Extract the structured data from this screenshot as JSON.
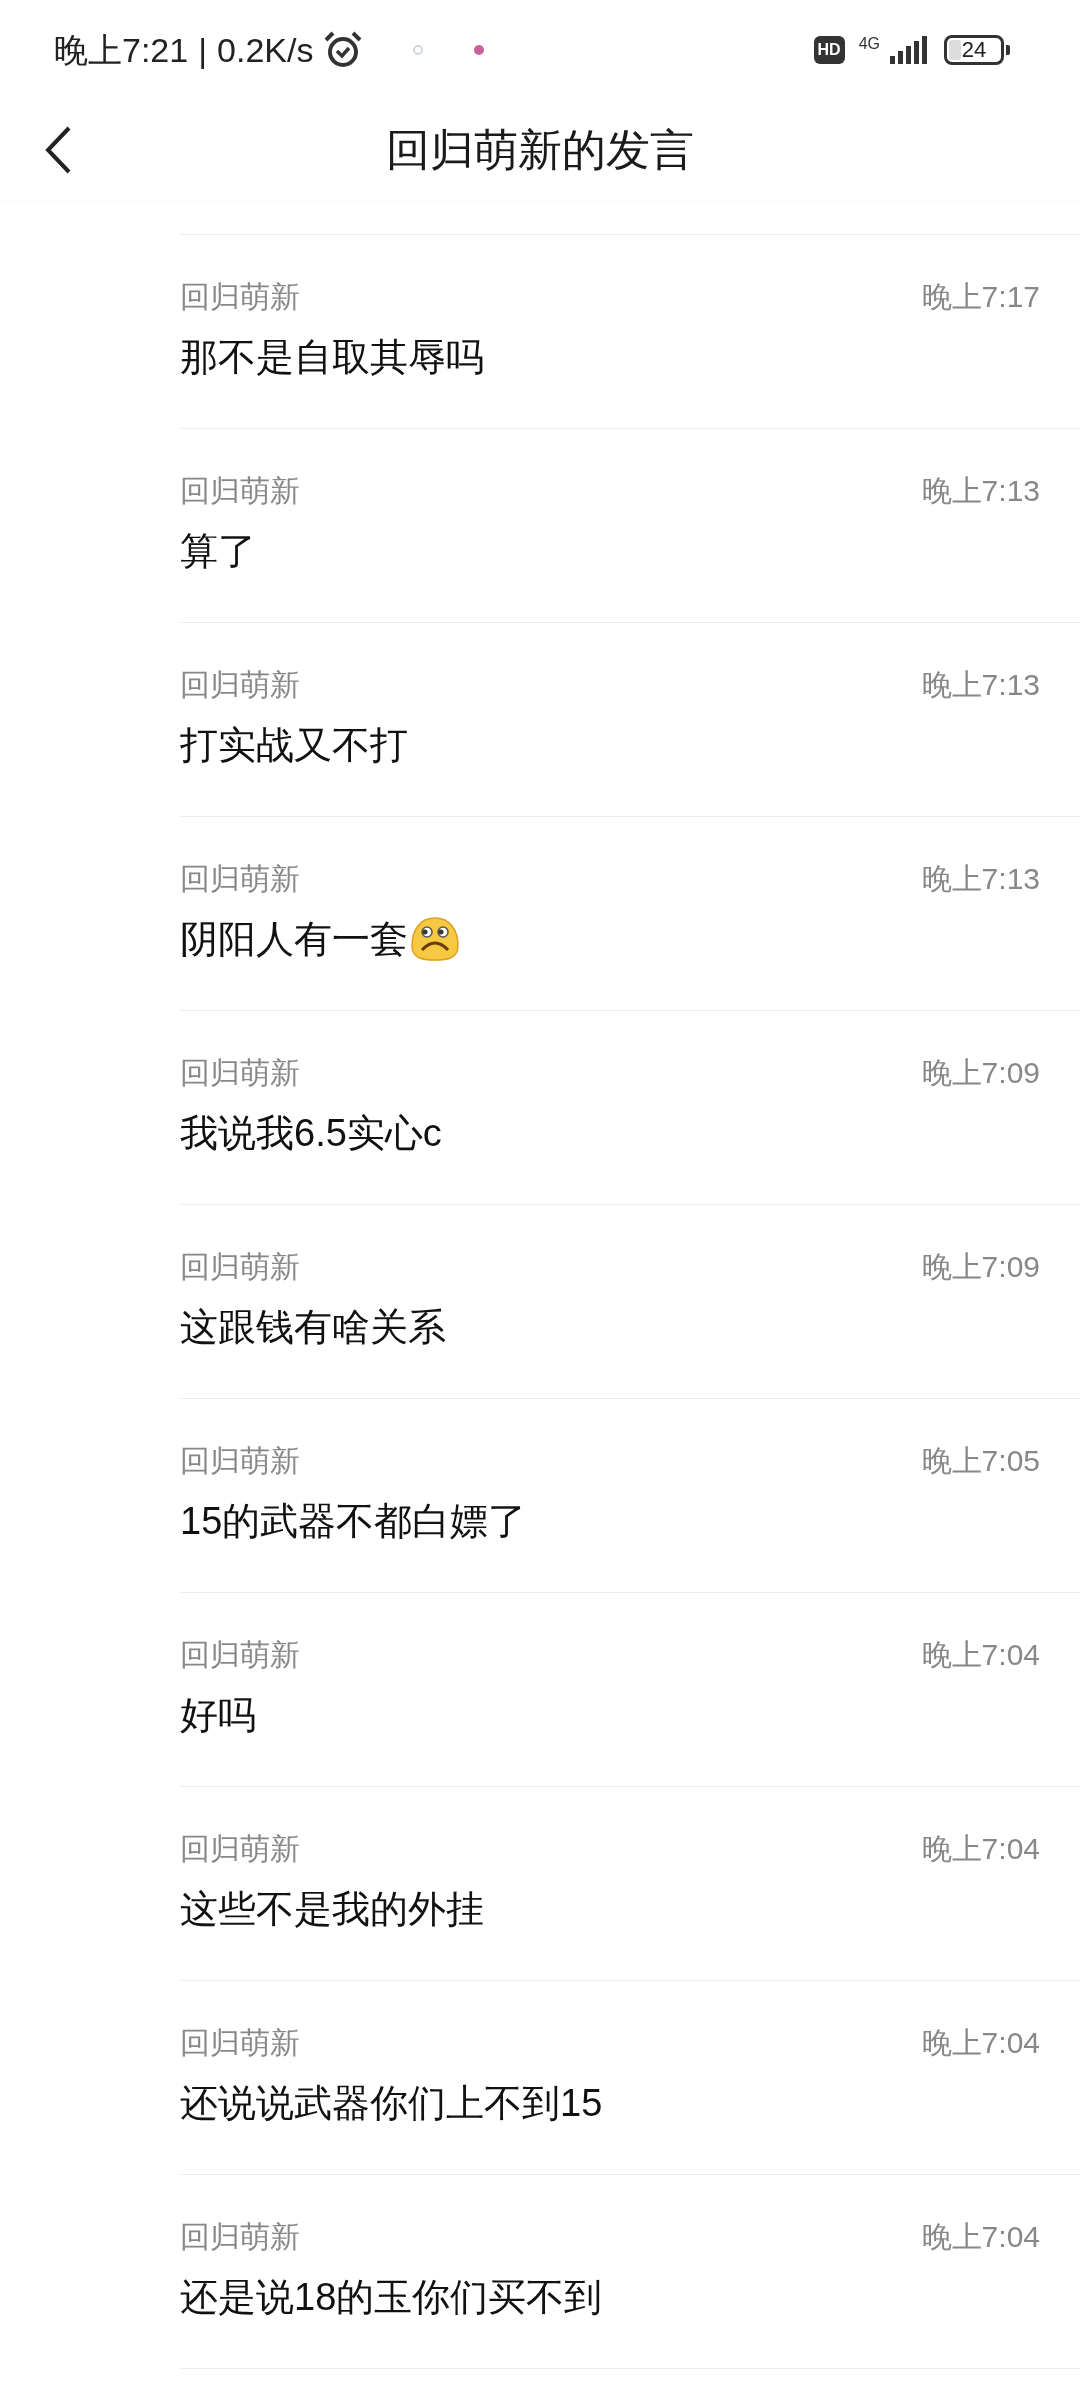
{
  "status_bar": {
    "time": "晚上7:21",
    "separator": "|",
    "speed": "0.2K/s",
    "hd": "HD",
    "network": "4G",
    "battery": "24"
  },
  "header": {
    "title": "回归萌新的发言"
  },
  "messages": [
    {
      "author": "回归萌新",
      "time": "晚上7:17",
      "text": "那不是自取其辱吗",
      "has_emoji": false
    },
    {
      "author": "回归萌新",
      "time": "晚上7:13",
      "text": "算了",
      "has_emoji": false
    },
    {
      "author": "回归萌新",
      "time": "晚上7:13",
      "text": "打实战又不打",
      "has_emoji": false
    },
    {
      "author": "回归萌新",
      "time": "晚上7:13",
      "text": "阴阳人有一套",
      "has_emoji": true
    },
    {
      "author": "回归萌新",
      "time": "晚上7:09",
      "text": "我说我6.5实心c",
      "has_emoji": false
    },
    {
      "author": "回归萌新",
      "time": "晚上7:09",
      "text": "这跟钱有啥关系",
      "has_emoji": false
    },
    {
      "author": "回归萌新",
      "time": "晚上7:05",
      "text": "15的武器不都白嫖了",
      "has_emoji": false
    },
    {
      "author": "回归萌新",
      "time": "晚上7:04",
      "text": "好吗",
      "has_emoji": false
    },
    {
      "author": "回归萌新",
      "time": "晚上7:04",
      "text": "这些不是我的外挂",
      "has_emoji": false
    },
    {
      "author": "回归萌新",
      "time": "晚上7:04",
      "text": "还说说武器你们上不到15",
      "has_emoji": false
    },
    {
      "author": "回归萌新",
      "time": "晚上7:04",
      "text": "还是说18的玉你们买不到",
      "has_emoji": false
    }
  ]
}
